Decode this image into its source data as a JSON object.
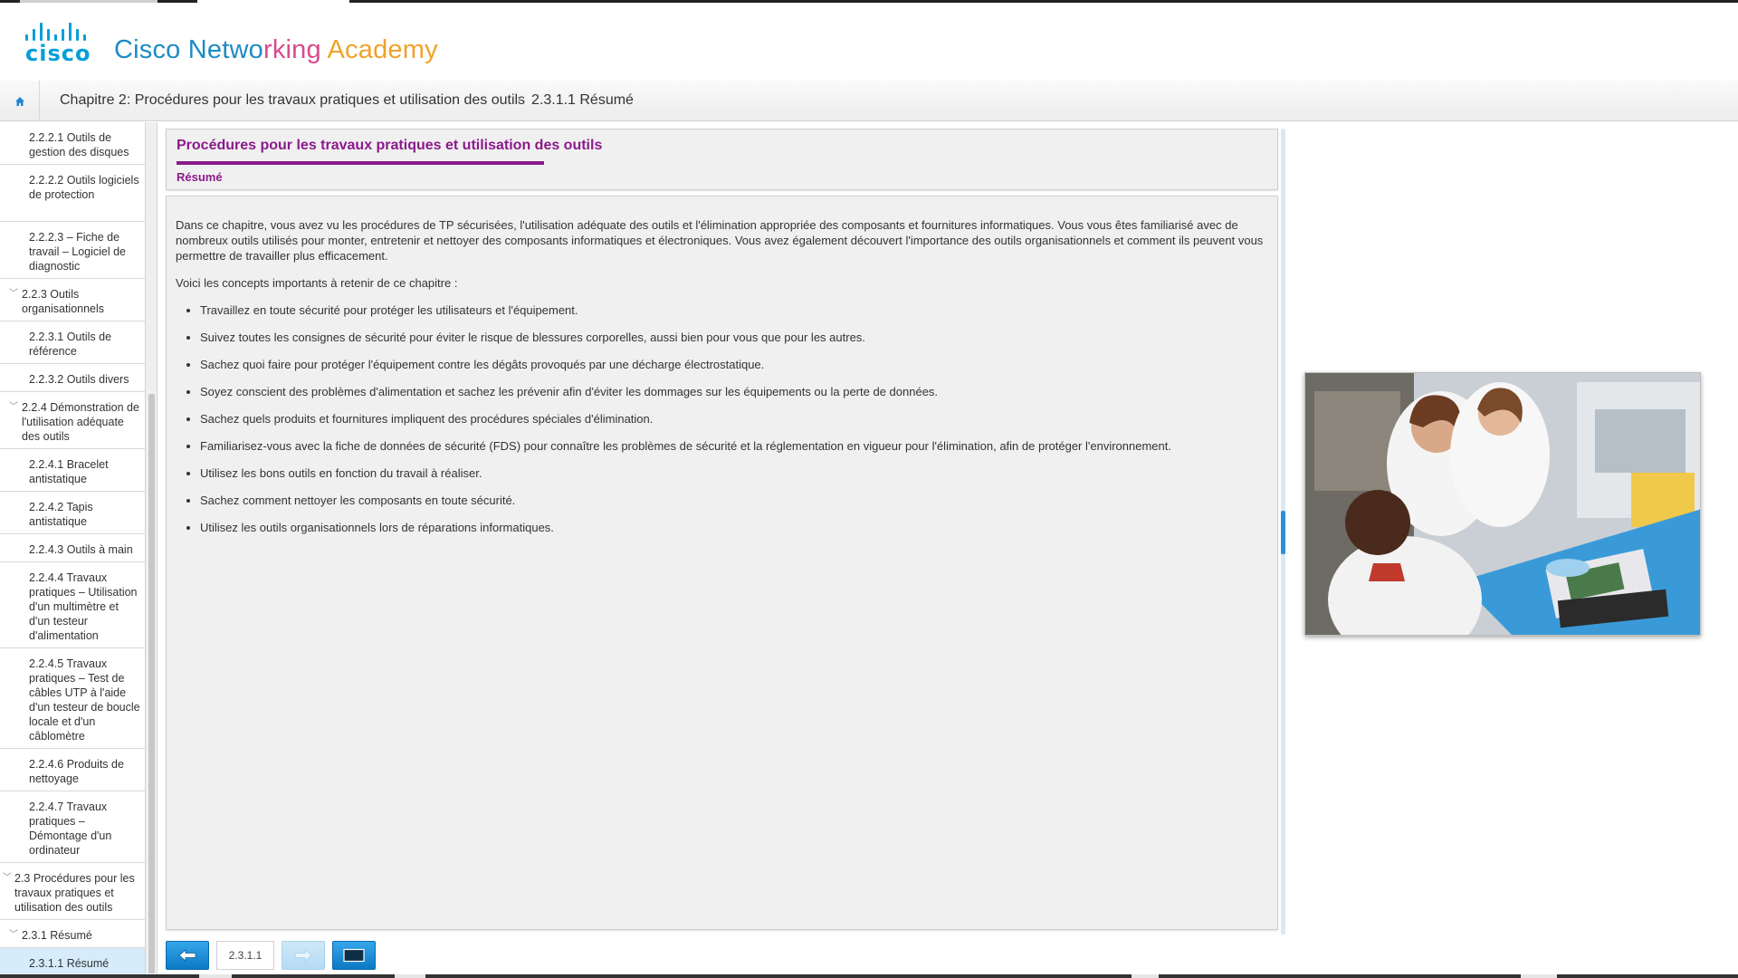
{
  "brand": {
    "logo_text": "cisco",
    "name_part1": "Cisco Netwo",
    "name_part2": "r",
    "name_part3": "king",
    "name_part4": " Academy",
    "accent_color": "#049fd9"
  },
  "breadcrumb": {
    "chapter": "Chapitre 2: Procédures pour les travaux pratiques et utilisation des outils",
    "current": "2.3.1.1 Résumé",
    "separator": "›"
  },
  "sidebar": {
    "items": [
      {
        "label": "2.2.2.1 Outils de gestion des disques",
        "level": 4
      },
      {
        "label": "2.2.2.2 Outils logiciels de protection",
        "level": 4
      },
      {
        "label": "2.2.2.3 – Fiche de travail – Logiciel de diagnostic",
        "level": 4
      },
      {
        "label": "2.2.3 Outils organisationnels",
        "level": 3,
        "expanded": true
      },
      {
        "label": "2.2.3.1 Outils de référence",
        "level": 4
      },
      {
        "label": "2.2.3.2 Outils divers",
        "level": 4
      },
      {
        "label": "2.2.4 Démonstration de l'utilisation adéquate des outils",
        "level": 3,
        "expanded": true
      },
      {
        "label": "2.2.4.1 Bracelet antistatique",
        "level": 4
      },
      {
        "label": "2.2.4.2 Tapis antistatique",
        "level": 4
      },
      {
        "label": "2.2.4.3 Outils à main",
        "level": 4
      },
      {
        "label": "2.2.4.4 Travaux pratiques – Utilisation d'un multimètre et d'un testeur d'alimentation",
        "level": 4
      },
      {
        "label": "2.2.4.5 Travaux pratiques – Test de câbles UTP à l'aide d'un testeur de boucle locale et d'un câblomètre",
        "level": 4
      },
      {
        "label": "2.2.4.6 Produits de nettoyage",
        "level": 4
      },
      {
        "label": "2.2.4.7 Travaux pratiques – Démontage d'un ordinateur",
        "level": 4
      },
      {
        "label": "2.3 Procédures pour les travaux pratiques et utilisation des outils",
        "level": 2,
        "expanded": true
      },
      {
        "label": "2.3.1 Résumé",
        "level": 3,
        "expanded": true
      },
      {
        "label": "2.3.1.1 Résumé",
        "level": 4,
        "active": true
      }
    ]
  },
  "content": {
    "title": "Procédures pour les travaux pratiques et utilisation des outils",
    "subtitle": "Résumé",
    "intro": "Dans ce chapitre, vous avez vu les procédures de TP sécurisées, l'utilisation adéquate des outils et l'élimination appropriée des composants et fournitures informatiques. Vous vous êtes familiarisé avec de nombreux outils utilisés pour monter, entretenir et nettoyer des composants informatiques et électroniques. Vous avez également découvert l'importance des outils organisationnels et comment ils peuvent vous permettre de travailler plus efficacement.",
    "concepts_heading": "Voici les concepts importants à retenir de ce chapitre :",
    "concepts": [
      "Travaillez en toute sécurité pour protéger les utilisateurs et l'équipement.",
      "Suivez toutes les consignes de sécurité pour éviter le risque de blessures corporelles, aussi bien pour vous que pour les autres.",
      "Sachez quoi faire pour protéger l'équipement contre les dégâts provoqués par une décharge électrostatique.",
      "Soyez conscient des problèmes d'alimentation et sachez les prévenir afin d'éviter les dommages sur les équipements ou la perte de données.",
      "Sachez quels produits et fournitures impliquent des procédures spéciales d'élimination.",
      "Familiarisez-vous avec la fiche de données de sécurité (FDS) pour connaître les problèmes de sécurité et la réglementation en vigueur pour l'élimination, afin de protéger l'environnement.",
      "Utilisez les bons outils en fonction du travail à réaliser.",
      "Sachez comment nettoyer les composants en toute sécurité.",
      "Utilisez les outils organisationnels lors de réparations informatiques."
    ],
    "title_color": "#8b1a8b"
  },
  "footer_nav": {
    "page_number": "2.3.1.1",
    "prev_icon": "arrow-left-icon",
    "next_icon": "arrow-right-icon",
    "toggle_icon": "fullscreen-icon"
  }
}
